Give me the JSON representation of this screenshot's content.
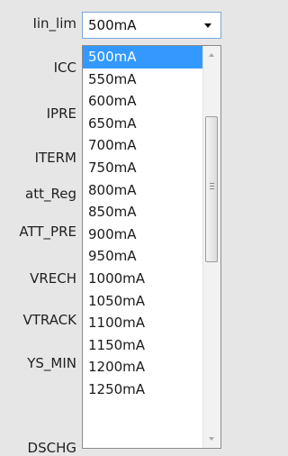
{
  "labels": [
    "Iin_lim",
    "ICC",
    "IPRE",
    "ITERM",
    "att_Reg",
    "ATT_PRE",
    "VRECH",
    "VTRACK",
    "YS_MIN",
    "DSCHG"
  ],
  "combo": {
    "value": "500mA"
  },
  "dropdown": {
    "options": [
      "500mA",
      "550mA",
      "600mA",
      "650mA",
      "700mA",
      "750mA",
      "800mA",
      "850mA",
      "900mA",
      "950mA",
      "1000mA",
      "1050mA",
      "1100mA",
      "1150mA",
      "1200mA",
      "1250mA"
    ],
    "selected_index": 0
  },
  "colors": {
    "selection": "#3399ff",
    "focus_border": "#7aa7d6"
  },
  "icons": {
    "combo_arrow": "chevron-down-icon",
    "scroll_up": "scroll-up-arrow-icon",
    "scroll_down": "scroll-down-arrow-icon"
  }
}
